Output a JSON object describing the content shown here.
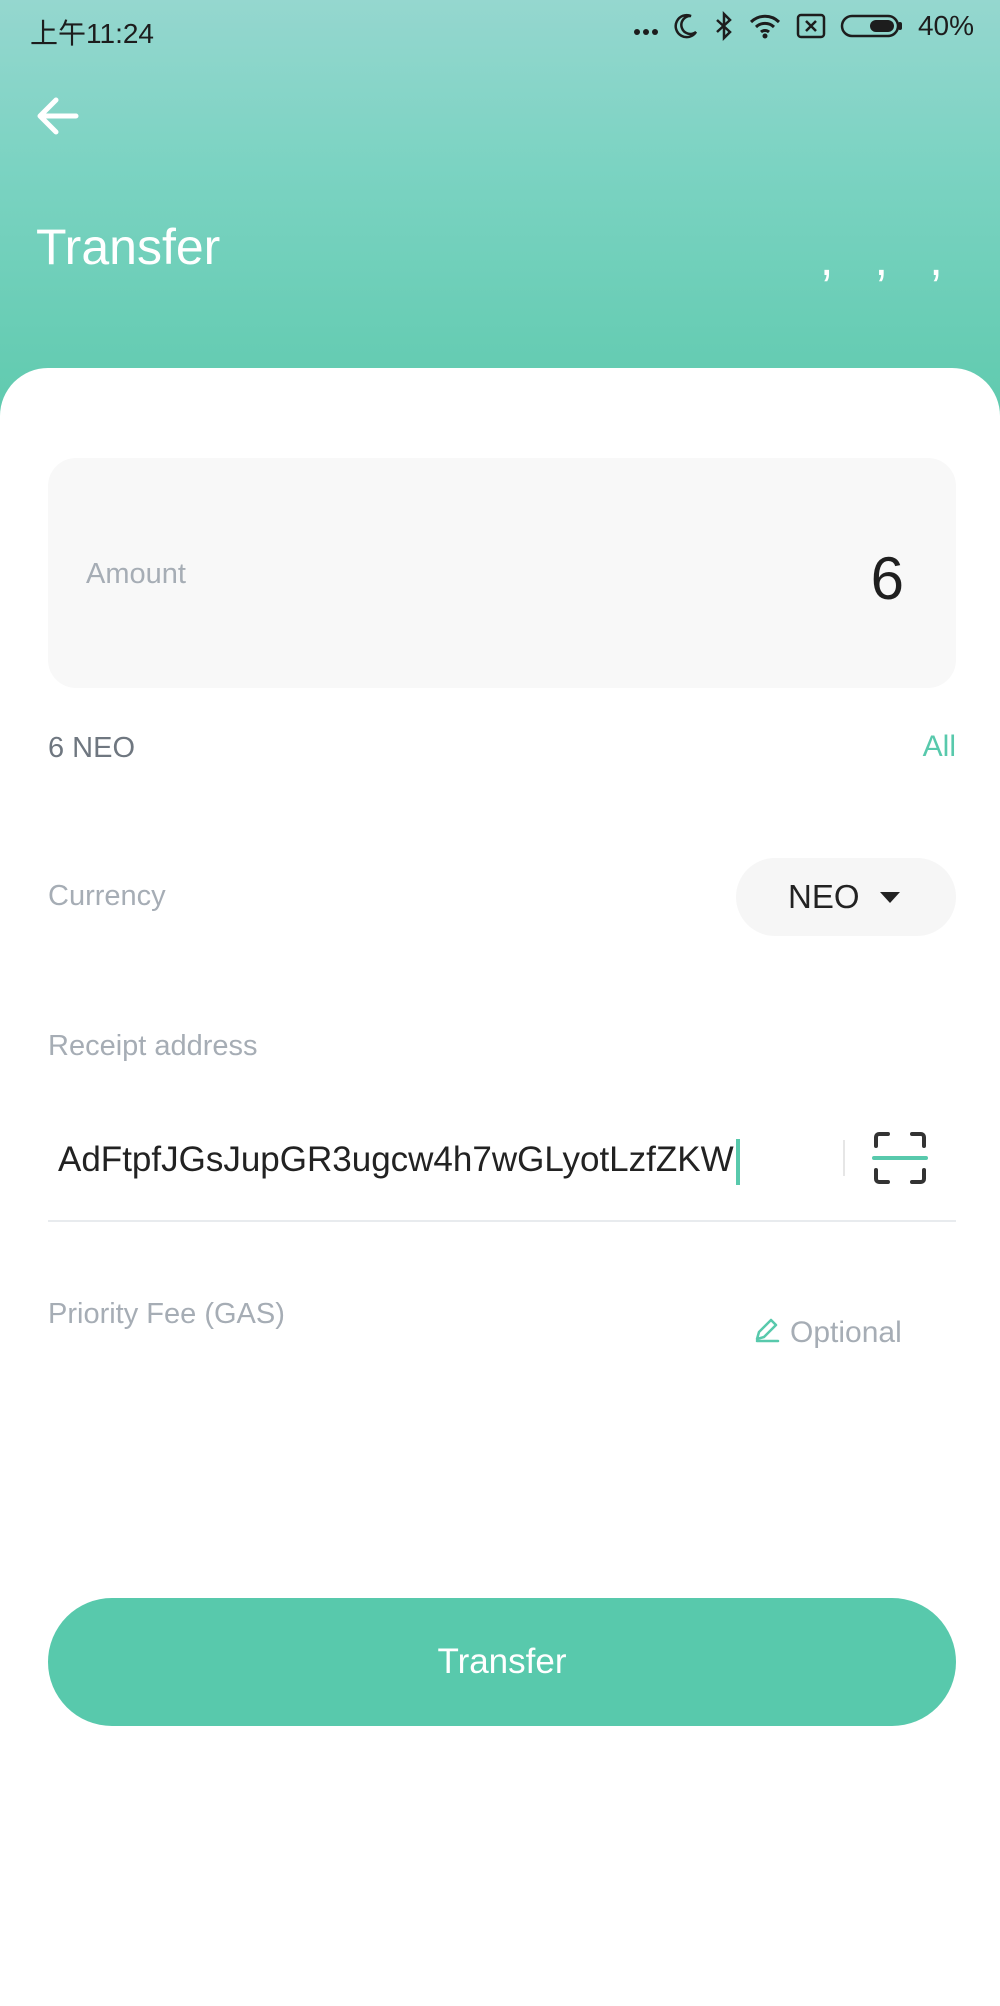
{
  "status_bar": {
    "time": "上午11:24",
    "battery_percent": "40%",
    "icons": [
      "more-dots-icon",
      "moon-icon",
      "bluetooth-icon",
      "wifi-icon",
      "no-sim-icon",
      "battery-icon"
    ]
  },
  "header": {
    "title": "Transfer",
    "decoration": ", , ,"
  },
  "amount": {
    "label": "Amount",
    "value": "6"
  },
  "balance": {
    "text": "6 NEO",
    "all_label": "All"
  },
  "currency": {
    "label": "Currency",
    "selected": "NEO"
  },
  "receipt": {
    "label": "Receipt address",
    "value": "AdFtpfJGsJupGR3ugcw4h7wGLyotLzfZKW"
  },
  "fee": {
    "label": "Priority Fee (GAS)",
    "optional_label": "Optional"
  },
  "transfer_button": {
    "label": "Transfer"
  },
  "colors": {
    "accent": "#58c9ac",
    "header_top": "#95d7cf",
    "header_bottom": "#5fcaae",
    "label_gray": "#a6adb5"
  }
}
